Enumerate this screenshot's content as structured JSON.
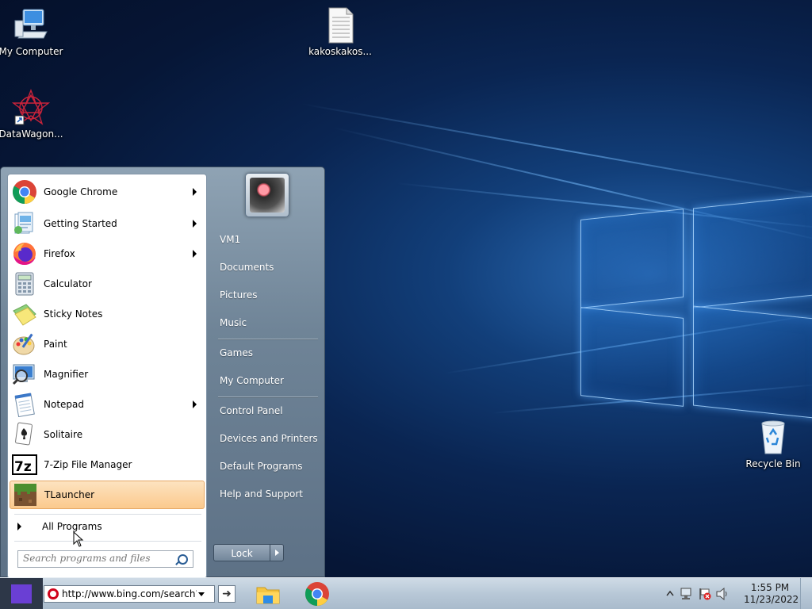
{
  "desktop": {
    "icons": [
      {
        "label": "My Computer"
      },
      {
        "label": "kakoskakos..."
      },
      {
        "label": "DataWagon..."
      },
      {
        "label": "Recycle Bin"
      }
    ]
  },
  "start_menu": {
    "programs": [
      {
        "label": "Google Chrome",
        "icon": "chrome-icon",
        "has_submenu": true
      },
      {
        "label": "Getting Started",
        "icon": "getting-started-icon",
        "has_submenu": true
      },
      {
        "label": "Firefox",
        "icon": "firefox-icon",
        "has_submenu": true
      },
      {
        "label": "Calculator",
        "icon": "calculator-icon",
        "has_submenu": false
      },
      {
        "label": "Sticky Notes",
        "icon": "sticky-notes-icon",
        "has_submenu": false
      },
      {
        "label": "Paint",
        "icon": "paint-icon",
        "has_submenu": false
      },
      {
        "label": "Magnifier",
        "icon": "magnifier-icon",
        "has_submenu": false
      },
      {
        "label": "Notepad",
        "icon": "notepad-icon",
        "has_submenu": true
      },
      {
        "label": "Solitaire",
        "icon": "solitaire-icon",
        "has_submenu": false
      },
      {
        "label": "7-Zip File Manager",
        "icon": "7zip-icon",
        "has_submenu": false
      },
      {
        "label": "TLauncher",
        "icon": "tlauncher-icon",
        "has_submenu": false,
        "highlighted": true
      }
    ],
    "all_programs_label": "All Programs",
    "search_placeholder": "Search programs and files",
    "right_links": [
      {
        "label": "VM1"
      },
      {
        "label": "Documents"
      },
      {
        "label": "Pictures"
      },
      {
        "label": "Music"
      },
      {
        "label": "Games"
      },
      {
        "label": "My Computer"
      },
      {
        "label": "Control Panel"
      },
      {
        "label": "Devices and Printers"
      },
      {
        "label": "Default Programs"
      },
      {
        "label": "Help and Support"
      }
    ],
    "lock_label": "Lock"
  },
  "taskbar": {
    "address_value": "http://www.bing.com/search?q=",
    "pinned": [
      "file-explorer-icon",
      "chrome-icon"
    ],
    "clock_time": "1:55 PM",
    "clock_date": "11/23/2022"
  },
  "colors": {
    "highlight": "#fbc98d",
    "wallpaper": "#0a2552",
    "start_button": "#6a3fd4"
  }
}
